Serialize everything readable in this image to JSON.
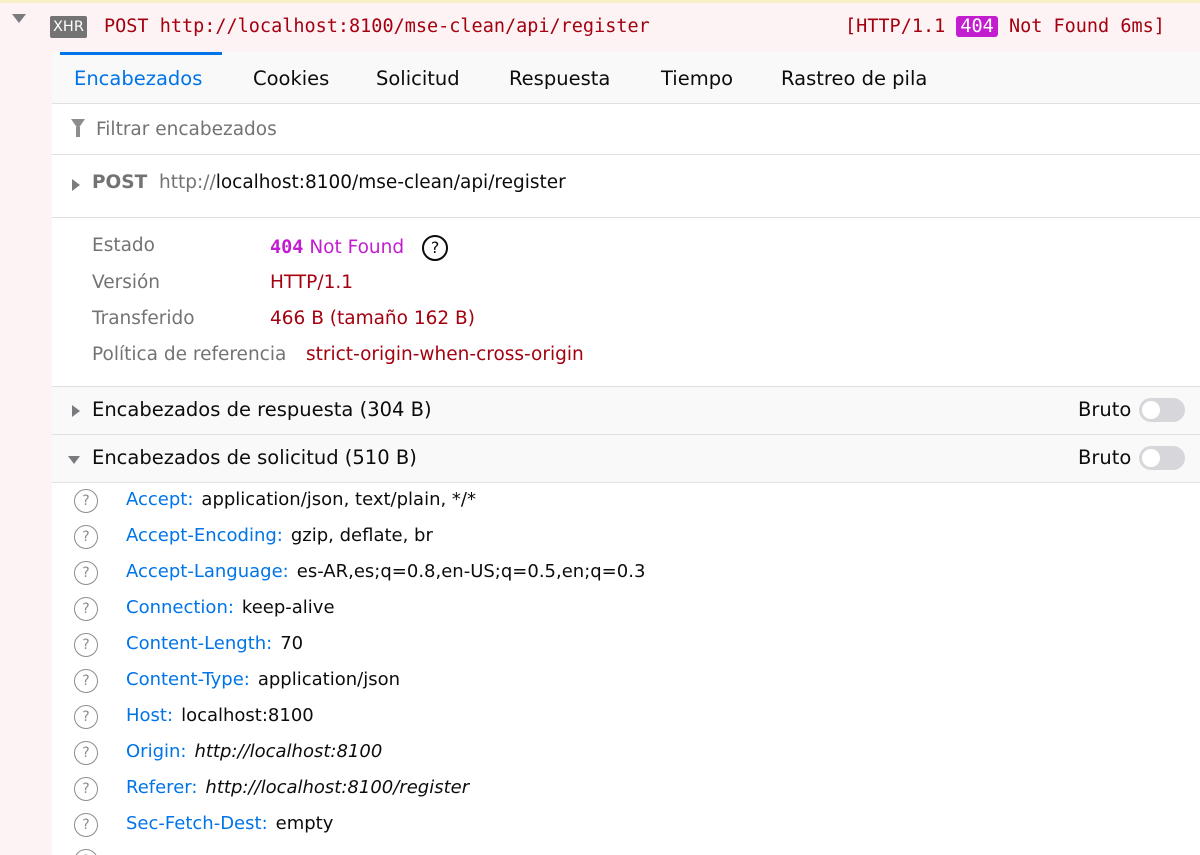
{
  "request": {
    "badge": "XHR",
    "line": "POST http://localhost:8100/mse-clean/api/register",
    "status_prefix": "[HTTP/1.1",
    "status_code": "404",
    "status_suffix": "Not Found 6ms]"
  },
  "tabs": [
    "Encabezados",
    "Cookies",
    "Solicitud",
    "Respuesta",
    "Tiempo",
    "Rastreo de pila"
  ],
  "filter": {
    "placeholder": "Filtrar encabezados"
  },
  "summary": {
    "method": "POST",
    "proto": "http://",
    "url": "localhost:8100/mse-clean/api/register"
  },
  "meta": {
    "estado_label": "Estado",
    "estado_code": "404",
    "estado_text": "Not Found",
    "help": "?",
    "version_label": "Versión",
    "version_value": "HTTP/1.1",
    "transferido_label": "Transferido",
    "transferido_value": "466 B (tamaño 162 B)",
    "politica_label": "Política de referencia",
    "politica_value": "strict-origin-when-cross-origin"
  },
  "response_section": {
    "title": "Encabezados de respuesta (304 B)",
    "raw_label": "Bruto"
  },
  "request_section": {
    "title": "Encabezados de solicitud (510 B)",
    "raw_label": "Bruto"
  },
  "request_headers": [
    {
      "name": "Accept:",
      "value": "application/json, text/plain, */*"
    },
    {
      "name": "Accept-Encoding:",
      "value": "gzip, deflate, br"
    },
    {
      "name": "Accept-Language:",
      "value": "es-AR,es;q=0.8,en-US;q=0.5,en;q=0.3"
    },
    {
      "name": "Connection:",
      "value": "keep-alive"
    },
    {
      "name": "Content-Length:",
      "value": "70"
    },
    {
      "name": "Content-Type:",
      "value": "application/json"
    },
    {
      "name": "Host:",
      "value": "localhost:8100"
    },
    {
      "name": "Origin:",
      "value": "http://localhost:8100"
    },
    {
      "name": "Referer:",
      "value": "http://localhost:8100/register"
    },
    {
      "name": "Sec-Fetch-Dest:",
      "value": "empty"
    }
  ]
}
